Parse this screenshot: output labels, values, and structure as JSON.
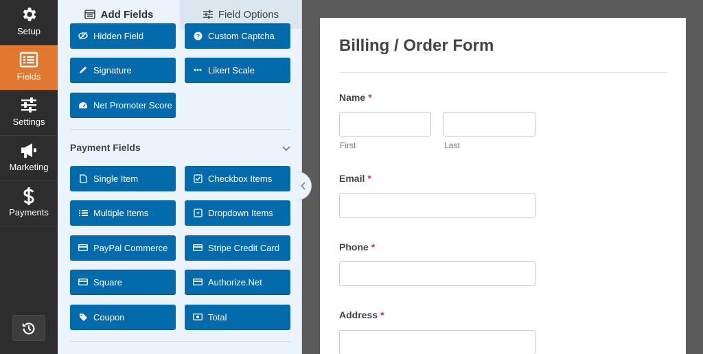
{
  "nav": {
    "items": [
      {
        "label": "Setup",
        "icon": "gear-icon"
      },
      {
        "label": "Fields",
        "icon": "fields-list-icon",
        "active": true
      },
      {
        "label": "Settings",
        "icon": "sliders-icon"
      },
      {
        "label": "Marketing",
        "icon": "megaphone-icon"
      },
      {
        "label": "Payments",
        "icon": "dollar-icon"
      }
    ],
    "history_icon": "history-icon"
  },
  "panel": {
    "tabs": [
      {
        "label": "Add Fields",
        "icon": "list-icon",
        "active": true
      },
      {
        "label": "Field Options",
        "icon": "sliders-icon"
      }
    ],
    "fancy_fields": [
      {
        "label": "Hidden Field",
        "icon": "eye-slash-icon"
      },
      {
        "label": "Custom Captcha",
        "icon": "question-circle-icon"
      },
      {
        "label": "Signature",
        "icon": "pen-icon"
      },
      {
        "label": "Likert Scale",
        "icon": "dots-icon"
      },
      {
        "label": "Net Promoter Score",
        "icon": "gauge-icon"
      }
    ],
    "payment_section": {
      "title": "Payment Fields",
      "chevron_icon": "chevron-down-icon",
      "fields": [
        {
          "label": "Single Item",
          "icon": "file-icon"
        },
        {
          "label": "Checkbox Items",
          "icon": "checkbox-icon"
        },
        {
          "label": "Multiple Items",
          "icon": "list-icon"
        },
        {
          "label": "Dropdown Items",
          "icon": "dropdown-icon"
        },
        {
          "label": "PayPal Commerce",
          "icon": "credit-card-icon"
        },
        {
          "label": "Stripe Credit Card",
          "icon": "credit-card-icon"
        },
        {
          "label": "Square",
          "icon": "credit-card-icon"
        },
        {
          "label": "Authorize.Net",
          "icon": "credit-card-icon"
        },
        {
          "label": "Coupon",
          "icon": "tag-icon"
        },
        {
          "label": "Total",
          "icon": "money-icon"
        }
      ]
    }
  },
  "form": {
    "title": "Billing / Order Form",
    "required_mark": "*",
    "fields": {
      "name": {
        "label": "Name",
        "first": "First",
        "last": "Last"
      },
      "email": {
        "label": "Email"
      },
      "phone": {
        "label": "Phone"
      },
      "address": {
        "label": "Address"
      }
    }
  },
  "colors": {
    "accent": "#e27730",
    "button": "#036aab",
    "nav_bg": "#2d2d2d",
    "panel_bg": "#ebf3fc",
    "required": "#d63638"
  }
}
